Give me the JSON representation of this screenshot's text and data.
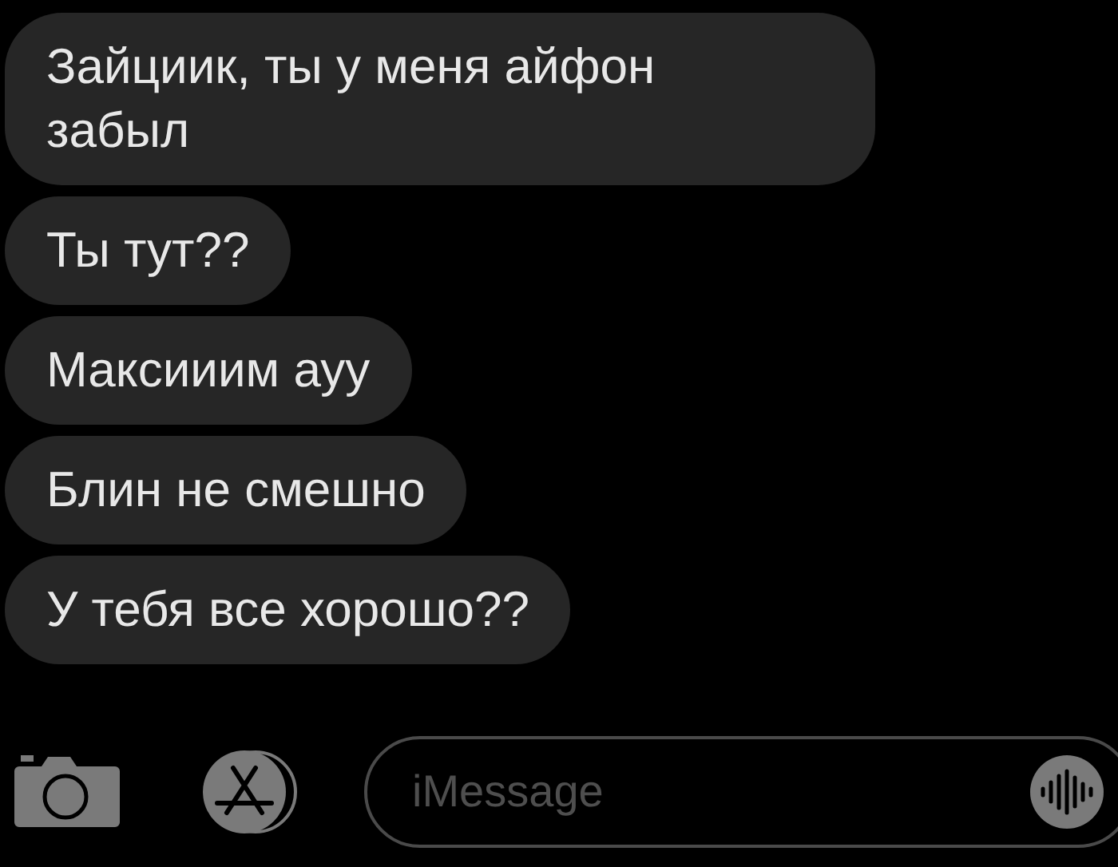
{
  "messages": [
    {
      "text": "Зайциик, ты у меня айфон забыл"
    },
    {
      "text": "Ты тут??"
    },
    {
      "text": "Максииим ауу"
    },
    {
      "text": "Блин не смешно"
    },
    {
      "text": "У тебя все хорошо??"
    }
  ],
  "composer": {
    "placeholder": "iMessage"
  }
}
